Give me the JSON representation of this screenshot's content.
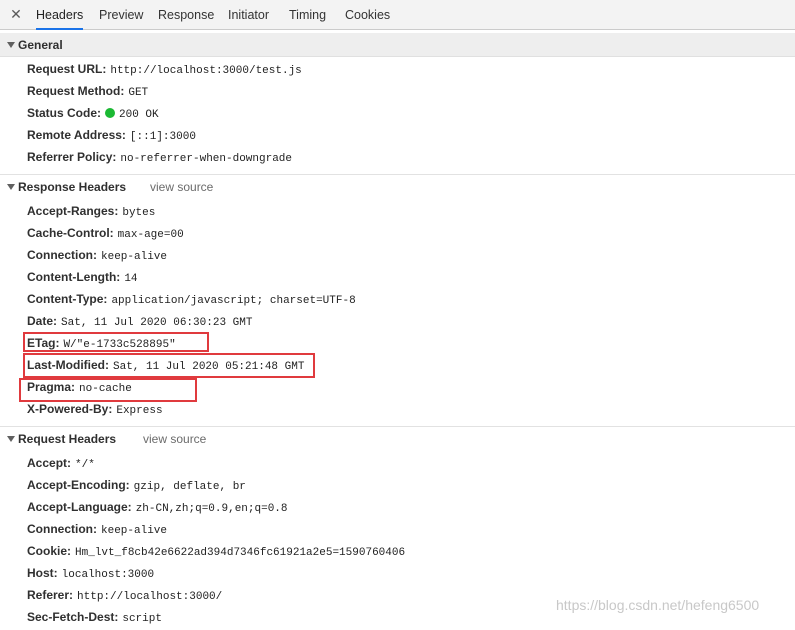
{
  "tabs": [
    "Headers",
    "Preview",
    "Response",
    "Initiator",
    "Timing",
    "Cookies"
  ],
  "close_glyph": "✕",
  "general": {
    "title": "General",
    "rows": [
      {
        "key": "Request URL:",
        "value": "http://localhost:3000/test.js"
      },
      {
        "key": "Request Method:",
        "value": "GET"
      },
      {
        "key": "Status Code:",
        "value": "200 OK",
        "status_color": "#1bb933"
      },
      {
        "key": "Remote Address:",
        "value": "[::1]:3000"
      },
      {
        "key": "Referrer Policy:",
        "value": "no-referrer-when-downgrade"
      }
    ]
  },
  "response": {
    "title": "Response Headers",
    "view_source": "view source",
    "rows": [
      {
        "key": "Accept-Ranges:",
        "value": "bytes"
      },
      {
        "key": "Cache-Control:",
        "value": "max-age=00"
      },
      {
        "key": "Connection:",
        "value": "keep-alive"
      },
      {
        "key": "Content-Length:",
        "value": "14"
      },
      {
        "key": "Content-Type:",
        "value": "application/javascript; charset=UTF-8"
      },
      {
        "key": "Date:",
        "value": "Sat, 11 Jul 2020 06:30:23 GMT"
      },
      {
        "key": "ETag:",
        "value": "W/\"e-1733c528895\""
      },
      {
        "key": "Last-Modified:",
        "value": "Sat, 11 Jul 2020 05:21:48 GMT"
      },
      {
        "key": "Pragma:",
        "value": "no-cache"
      },
      {
        "key": "X-Powered-By:",
        "value": "Express"
      }
    ]
  },
  "request": {
    "title": "Request Headers",
    "view_source": "view source",
    "rows": [
      {
        "key": "Accept:",
        "value": "*/*"
      },
      {
        "key": "Accept-Encoding:",
        "value": "gzip, deflate, br"
      },
      {
        "key": "Accept-Language:",
        "value": "zh-CN,zh;q=0.9,en;q=0.8"
      },
      {
        "key": "Connection:",
        "value": "keep-alive"
      },
      {
        "key": "Cookie:",
        "value": "Hm_lvt_f8cb42e6622ad394d7346fc61921a2e5=1590760406"
      },
      {
        "key": "Host:",
        "value": "localhost:3000"
      },
      {
        "key": "Referer:",
        "value": "http://localhost:3000/"
      },
      {
        "key": "Sec-Fetch-Dest:",
        "value": "script"
      }
    ]
  },
  "highlight_color": "#e03a3e",
  "watermark": "https://blog.csdn.net/hefeng6500"
}
